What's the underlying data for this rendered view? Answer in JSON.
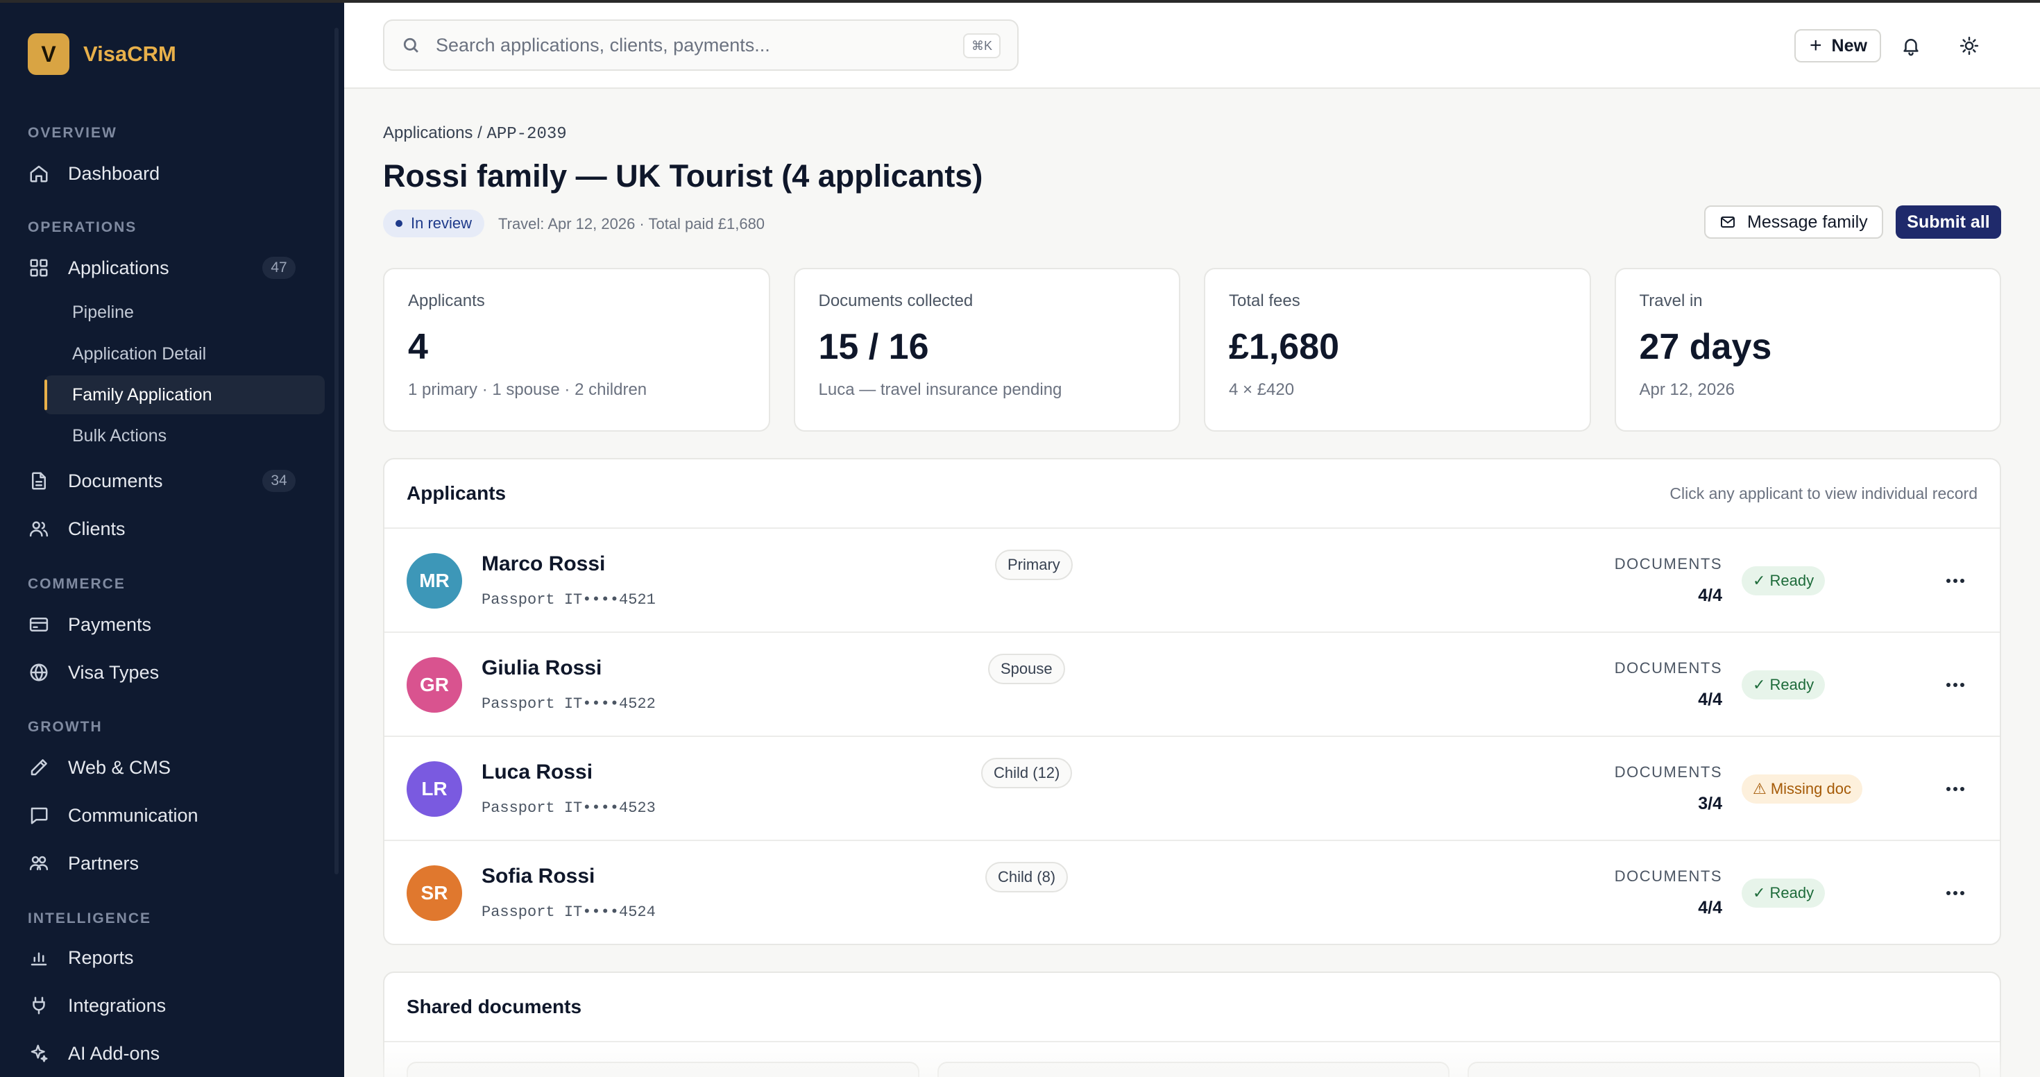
{
  "brand": {
    "initial": "V",
    "name": "VisaCRM"
  },
  "sidebar": {
    "sections": {
      "overview": "OVERVIEW",
      "operations": "OPERATIONS",
      "commerce": "COMMERCE",
      "growth": "GROWTH",
      "intelligence": "INTELLIGENCE"
    },
    "items": {
      "dashboard": "Dashboard",
      "applications": "Applications",
      "applications_count": "47",
      "pipeline": "Pipeline",
      "application_detail": "Application Detail",
      "family_application": "Family Application",
      "bulk_actions": "Bulk Actions",
      "documents": "Documents",
      "documents_count": "34",
      "clients": "Clients",
      "payments": "Payments",
      "visa_types": "Visa Types",
      "web_cms": "Web & CMS",
      "communication": "Communication",
      "partners": "Partners",
      "reports": "Reports",
      "integrations": "Integrations",
      "ai_addons": "AI Add-ons"
    }
  },
  "topbar": {
    "search_placeholder": "Search applications, clients, payments...",
    "shortcut": "⌘K",
    "new_label": "New"
  },
  "page": {
    "breadcrumb_root": "Applications",
    "breadcrumb_sep": " / ",
    "breadcrumb_code": "APP-2039",
    "title": "Rossi family — UK Tourist (4 applicants)",
    "status": "In review",
    "meta": "Travel: Apr 12, 2026 · Total paid £1,680",
    "message_label": "Message family",
    "submit_label": "Submit all"
  },
  "stats": [
    {
      "label": "Applicants",
      "value": "4",
      "sub": "1 primary · 1 spouse · 2 children"
    },
    {
      "label": "Documents collected",
      "value": "15 / 16",
      "sub": "Luca — travel insurance pending"
    },
    {
      "label": "Total fees",
      "value": "£1,680",
      "sub": "4 × £420"
    },
    {
      "label": "Travel in",
      "value": "27 days",
      "sub": "Apr 12, 2026"
    }
  ],
  "applicants": {
    "title": "Applicants",
    "hint": "Click any applicant to view individual record",
    "doc_label": "DOCUMENTS",
    "rows": [
      {
        "initials": "MR",
        "name": "Marco Rossi",
        "role": "Primary",
        "passport": "Passport IT••••4521",
        "docs": "4/4",
        "status": "✓ Ready",
        "color": "#3d97b8"
      },
      {
        "initials": "GR",
        "name": "Giulia Rossi",
        "role": "Spouse",
        "passport": "Passport IT••••4522",
        "docs": "4/4",
        "status": "✓ Ready",
        "color": "#d9538f"
      },
      {
        "initials": "LR",
        "name": "Luca Rossi",
        "role": "Child (12)",
        "passport": "Passport IT••••4523",
        "docs": "3/4",
        "status": "⚠ Missing doc",
        "color": "#7a5ae0"
      },
      {
        "initials": "SR",
        "name": "Sofia Rossi",
        "role": "Child (8)",
        "passport": "Passport IT••••4524",
        "docs": "4/4",
        "status": "✓ Ready",
        "color": "#e0782e"
      }
    ]
  },
  "shared": {
    "title": "Shared documents"
  }
}
